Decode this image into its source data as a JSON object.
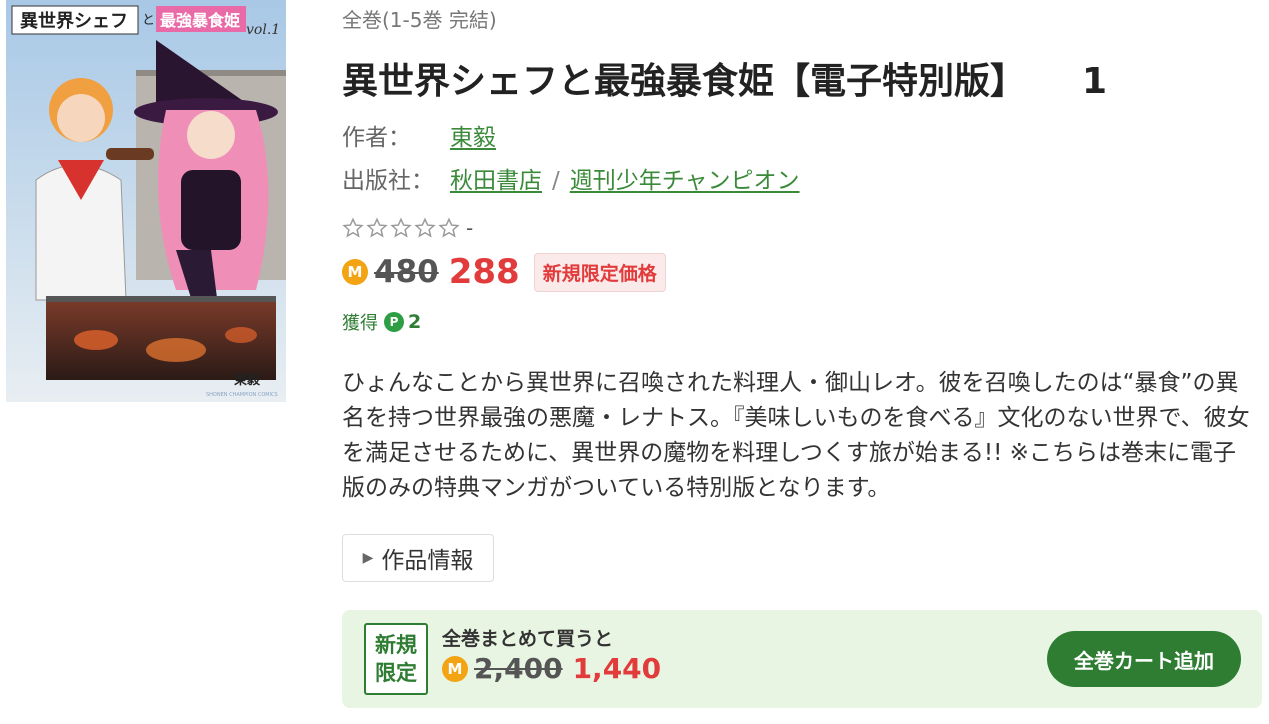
{
  "cover": {
    "logo_text_1": "異世界シェフ",
    "logo_text_2": "と",
    "logo_text_3": "最強暴食姫",
    "vol_text": "vol.1",
    "author_text": "東毅",
    "imprint_text": "SHONEN CHAMPION COMICS"
  },
  "series_note": "全巻(1-5巻 完結)",
  "title": "異世界シェフと最強暴食姫【電子特別版】",
  "volume": "1",
  "author": {
    "label": "作者：",
    "name": "東毅"
  },
  "publisher": {
    "label": "出版社：",
    "name": "秋田書店",
    "separator": "/",
    "magazine": "週刊少年チャンピオン"
  },
  "rating": {
    "stars_filled": 0,
    "stars_total": 5,
    "value_text": "-"
  },
  "price": {
    "coin": "M",
    "original": "480",
    "sale": "288",
    "badge": "新規限定価格"
  },
  "points": {
    "label": "獲得",
    "coin": "P",
    "value": "2"
  },
  "description": "ひょんなことから異世界に召喚された料理人・御山レオ。彼を召喚したのは“暴食”の異名を持つ世界最強の悪魔・レナトス。『美味しいものを食べる』文化のない世界で、彼女を満足させるために、異世界の魔物を料理しつくす旅が始まる!! ※こちらは巻末に電子版のみの特典マンガがついている特別版となります。",
  "info_toggle": {
    "label": "作品情報"
  },
  "bundle": {
    "badge_line1": "新規",
    "badge_line2": "限定",
    "text": "全巻まとめて買うと",
    "coin": "M",
    "original": "2,400",
    "sale": "1,440",
    "cart_button": "全巻カート追加"
  },
  "colors": {
    "link_green": "#3a8a3a",
    "sale_red": "#e23b3b",
    "brand_green": "#2e7d32",
    "bundle_bg": "#e8f5e3",
    "coin_orange": "#f2a413"
  }
}
